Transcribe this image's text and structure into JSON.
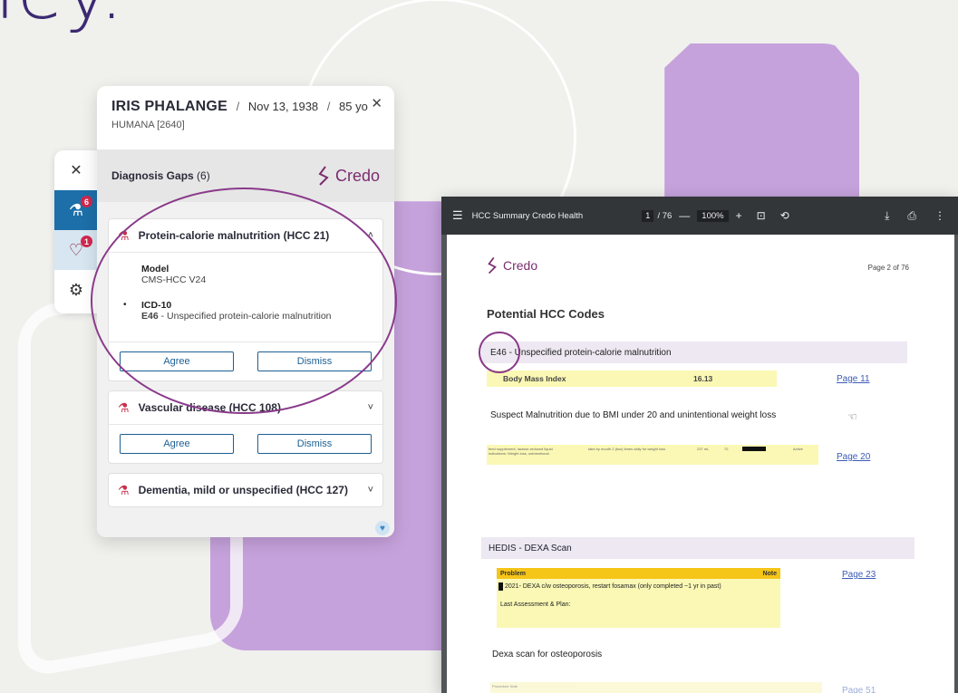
{
  "hero": {
    "text": "ley."
  },
  "rail": {
    "close_icon": "close-icon",
    "items": [
      {
        "icon": "microscope-icon",
        "badge": "6"
      },
      {
        "icon": "heart-pulse-icon",
        "badge": "1"
      },
      {
        "icon": "gear-icon"
      }
    ]
  },
  "patient": {
    "name": "IRIS PHALANGE",
    "dob": "Nov 13, 1938",
    "age": "85 yo",
    "insurer": "HUMANA [2640]"
  },
  "gaps": {
    "title": "Diagnosis Gaps",
    "count": "(6)",
    "brand": "Credo",
    "cards": [
      {
        "title": "Protein-calorie malnutrition (HCC 21)",
        "model_label": "Model",
        "model_value": "CMS-HCC V24",
        "icd_label": "ICD-10",
        "icd_code": "E46",
        "icd_desc": " - Unspecified protein-calorie malnutrition",
        "agree": "Agree",
        "dismiss": "Dismiss"
      },
      {
        "title": "Vascular disease (HCC 108)",
        "agree": "Agree",
        "dismiss": "Dismiss"
      },
      {
        "title": "Dementia, mild or unspecified (HCC 127)"
      }
    ]
  },
  "pdf": {
    "title": "HCC Summary Credo Health",
    "page_current": "1",
    "page_total": "/ 76",
    "zoom": "100%",
    "brand": "Credo",
    "page_label": "Page 2 of 76",
    "heading": "Potential HCC Codes",
    "code_row": "E46 - Unspecified protein-calorie malnutrition",
    "bmi_label": "Body Mass Index",
    "bmi_value": "16.13",
    "link_1": "Page 11",
    "suspect": "Suspect Malnutrition due to BMI under 20 and unintentional weight loss",
    "med_left": "feed supplement, lactose-reduced liquid",
    "med_left2": "indications: Weight loss, unintentional",
    "med_mid": "take by mouth 2 (two) times daily for weight loss",
    "med_qty": "237 mL",
    "med_num": "72",
    "med_status": "Active",
    "link_2": "Page 20",
    "hedis_band": "HEDIS - DEXA Scan",
    "problem_label": "Problem",
    "note_label": "Note",
    "problem_line": "2021- DEXA c/w osteoporosis, restart fosamax (only completed ~1 yr in past)",
    "assessment": "Last Assessment & Plan:",
    "link_3": "Page 23",
    "dexa": "Dexa scan for osteoporosis",
    "link_4": "Page 51",
    "faded_label": "Procedure Note"
  }
}
